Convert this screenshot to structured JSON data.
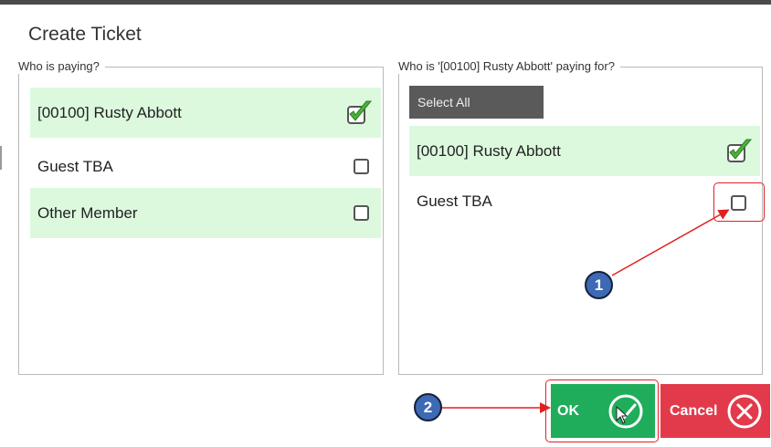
{
  "dialog": {
    "title": "Create Ticket"
  },
  "payer_panel": {
    "legend": "Who is paying?",
    "rows": [
      {
        "label": "[00100] Rusty Abbott",
        "checked": true,
        "highlighted": true
      },
      {
        "label": "Guest TBA",
        "checked": false,
        "highlighted": false
      },
      {
        "label": "Other Member",
        "checked": false,
        "highlighted": true
      }
    ]
  },
  "payee_panel": {
    "legend": "Who is '[00100] Rusty Abbott' paying for?",
    "select_all_label": "Select All",
    "rows": [
      {
        "label": "[00100] Rusty Abbott",
        "checked": true,
        "highlighted": true
      },
      {
        "label": "Guest TBA",
        "checked": false,
        "highlighted": false
      }
    ]
  },
  "buttons": {
    "ok_label": "OK",
    "cancel_label": "Cancel"
  },
  "annotations": {
    "step1": "1",
    "step2": "2"
  },
  "colors": {
    "selected_row": "#dcf9de",
    "ok_button": "#1fad5b",
    "cancel_button": "#e23a4a",
    "callout": "#e02020",
    "badge": "#3d69b5",
    "checkmark": "#4caf3c"
  }
}
